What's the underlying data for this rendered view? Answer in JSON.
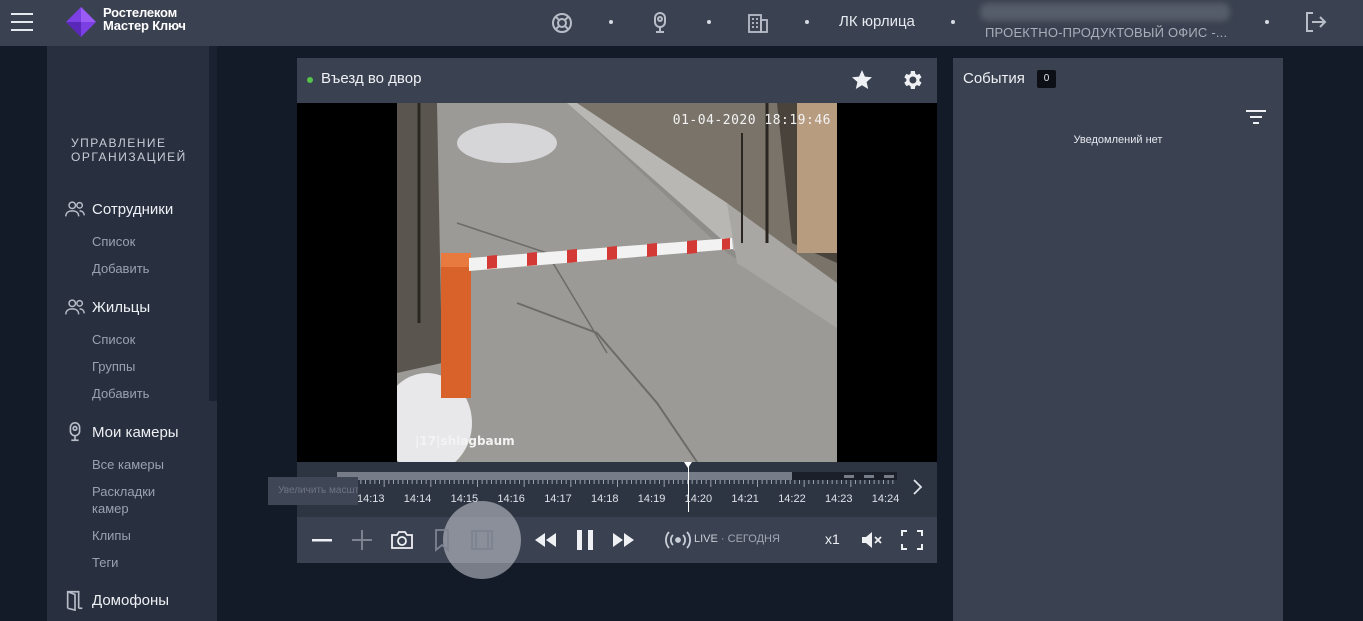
{
  "header": {
    "brand_line1": "Ростелеком",
    "brand_line2": "Мастер Ключ",
    "icons": [
      "support-icon",
      "intercom-icon",
      "building-icon"
    ],
    "account_label": "ЛК юрлица",
    "org_name": "ПРОЕКТНО-ПРОДУКТОВЫЙ ОФИС -...",
    "colors": {
      "bar": "#3a4150",
      "logo_purple": "#7b3fe4"
    }
  },
  "sidebar": {
    "section_title_line1": "УПРАВЛЕНИЕ",
    "section_title_line2": "ОРГАНИЗАЦИЕЙ",
    "groups": [
      {
        "label": "Сотрудники",
        "icon": "people-icon",
        "items": [
          "Список",
          "Добавить"
        ]
      },
      {
        "label": "Жильцы",
        "icon": "people-icon",
        "items": [
          "Список",
          "Группы",
          "Добавить"
        ]
      },
      {
        "label": "Мои камеры",
        "icon": "camera-icon",
        "items": [
          "Все камеры",
          "Раскладки камер",
          "Клипы",
          "Теги"
        ]
      },
      {
        "label": "Домофоны",
        "icon": "door-icon",
        "items": []
      }
    ]
  },
  "player": {
    "title": "Въезд во двор",
    "status_color": "#57c24a",
    "osd_timestamp": "01-04-2020 18:19:46",
    "osd_camera_name": "|17|shlagbaum",
    "timeline": {
      "labels": [
        ":",
        "14:13",
        "14:14",
        "14:15",
        "14:16",
        "14:17",
        "14:18",
        "14:19",
        "14:20",
        "14:21",
        "14:22",
        "14:23",
        "14:24"
      ],
      "tooltip": "Увеличить масштаб"
    },
    "controls": {
      "live": "LIVE",
      "live_sub": "СЕГОДНЯ",
      "separator": "·",
      "speed": "x1"
    }
  },
  "events": {
    "title": "События",
    "count": "0",
    "empty_text": "Уведомлений нет"
  }
}
